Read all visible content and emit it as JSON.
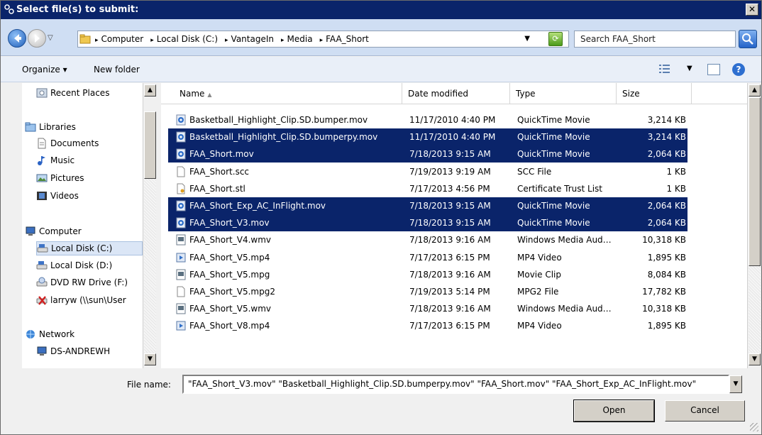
{
  "window": {
    "title": "Select file(s) to submit:",
    "close_label": "✕"
  },
  "address": {
    "crumbs": [
      "Computer",
      "Local Disk (C:)",
      "VantageIn",
      "Media",
      "FAA_Short"
    ],
    "search_placeholder": "Search FAA_Short"
  },
  "toolbar": {
    "organize_label": "Organize ▾",
    "new_folder_label": "New folder",
    "help_label": "?"
  },
  "nav": {
    "items": [
      {
        "label": "Recent Places",
        "icon": "recent-places-icon"
      },
      {
        "label": "Libraries",
        "icon": "libraries-icon"
      },
      {
        "label": "Documents",
        "icon": "documents-icon"
      },
      {
        "label": "Music",
        "icon": "music-icon"
      },
      {
        "label": "Pictures",
        "icon": "pictures-icon"
      },
      {
        "label": "Videos",
        "icon": "videos-icon"
      },
      {
        "label": "Computer",
        "icon": "computer-icon"
      },
      {
        "label": "Local Disk (C:)",
        "icon": "local-disk-icon",
        "selected": true
      },
      {
        "label": "Local Disk (D:)",
        "icon": "local-disk-icon"
      },
      {
        "label": "DVD RW Drive (F:)",
        "icon": "dvd-drive-icon"
      },
      {
        "label": "larryw (\\\\sun\\User",
        "icon": "network-drive-icon"
      },
      {
        "label": "Network",
        "icon": "network-icon"
      },
      {
        "label": "DS-ANDREWH",
        "icon": "computer-icon"
      }
    ]
  },
  "columns": {
    "name": "Name",
    "date": "Date modified",
    "type": "Type",
    "size": "Size"
  },
  "files": [
    {
      "name": "Basketball_Highlight_Clip.SD.bumper.mov",
      "date": "11/17/2010 4:40 PM",
      "type": "QuickTime Movie",
      "size": "3,214 KB",
      "icon": "quicktime-icon",
      "selected": false
    },
    {
      "name": "Basketball_Highlight_Clip.SD.bumperpy.mov",
      "date": "11/17/2010 4:40 PM",
      "type": "QuickTime Movie",
      "size": "3,214 KB",
      "icon": "quicktime-icon",
      "selected": true
    },
    {
      "name": "FAA_Short.mov",
      "date": "7/18/2013 9:15 AM",
      "type": "QuickTime Movie",
      "size": "2,064 KB",
      "icon": "quicktime-icon",
      "selected": true
    },
    {
      "name": "FAA_Short.scc",
      "date": "7/19/2013 9:19 AM",
      "type": "SCC File",
      "size": "1 KB",
      "icon": "blank-file-icon",
      "selected": false
    },
    {
      "name": "FAA_Short.stl",
      "date": "7/17/2013 4:56 PM",
      "type": "Certificate Trust List",
      "size": "1 KB",
      "icon": "certificate-icon",
      "selected": false
    },
    {
      "name": "FAA_Short_Exp_AC_InFlight.mov",
      "date": "7/18/2013 9:15 AM",
      "type": "QuickTime Movie",
      "size": "2,064 KB",
      "icon": "quicktime-icon",
      "selected": true
    },
    {
      "name": "FAA_Short_V3.mov",
      "date": "7/18/2013 9:15 AM",
      "type": "QuickTime Movie",
      "size": "2,064 KB",
      "icon": "quicktime-icon",
      "selected": true
    },
    {
      "name": "FAA_Short_V4.wmv",
      "date": "7/18/2013 9:16 AM",
      "type": "Windows Media Aud…",
      "size": "10,318 KB",
      "icon": "media-file-icon",
      "selected": false
    },
    {
      "name": "FAA_Short_V5.mp4",
      "date": "7/17/2013 6:15 PM",
      "type": "MP4 Video",
      "size": "1,895 KB",
      "icon": "mp4-icon",
      "selected": false
    },
    {
      "name": "FAA_Short_V5.mpg",
      "date": "7/18/2013 9:16 AM",
      "type": "Movie Clip",
      "size": "8,084 KB",
      "icon": "media-file-icon",
      "selected": false
    },
    {
      "name": "FAA_Short_V5.mpg2",
      "date": "7/19/2013 5:14 PM",
      "type": "MPG2 File",
      "size": "17,782 KB",
      "icon": "blank-file-icon",
      "selected": false
    },
    {
      "name": "FAA_Short_V5.wmv",
      "date": "7/18/2013 9:16 AM",
      "type": "Windows Media Aud…",
      "size": "10,318 KB",
      "icon": "media-file-icon",
      "selected": false
    },
    {
      "name": "FAA_Short_V8.mp4",
      "date": "7/17/2013 6:15 PM",
      "type": "MP4 Video",
      "size": "1,895 KB",
      "icon": "mp4-icon",
      "selected": false
    }
  ],
  "bottom": {
    "file_name_label": "File name:",
    "file_name_value": "\"FAA_Short_V3.mov\" \"Basketball_Highlight_Clip.SD.bumperpy.mov\" \"FAA_Short.mov\" \"FAA_Short_Exp_AC_InFlight.mov\"",
    "open_label": "Open",
    "cancel_label": "Cancel"
  }
}
